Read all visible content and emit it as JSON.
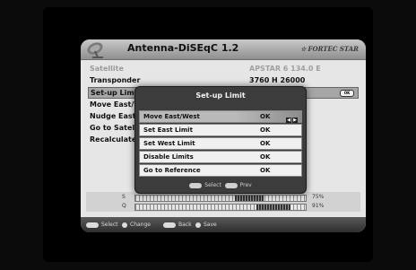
{
  "header": {
    "title": "Antenna-DiSEqC 1.2",
    "brand": "FORTEC STAR",
    "brand_star": "☆"
  },
  "rows": [
    {
      "label": "Satellite",
      "value": "APSTAR 6    134.0 E"
    },
    {
      "label": "Transponder",
      "value": "3760 H 26000"
    },
    {
      "label": "Set-up Limit",
      "value": ""
    },
    {
      "label": "Move East/W",
      "value": ""
    },
    {
      "label": "Nudge East/W",
      "value": ""
    },
    {
      "label": "Go to Satellite",
      "value": ""
    },
    {
      "label": "Recalculate",
      "value": ""
    }
  ],
  "ok_key": "OK",
  "signal": {
    "strength_label": "S",
    "quality_label": "Q",
    "strength_pct": "75%",
    "quality_pct": "91%",
    "strength_value": 75,
    "quality_value": 91
  },
  "footer": {
    "select": "Select",
    "change": "Change",
    "back": "Back",
    "save": "Save"
  },
  "popup": {
    "title": "Set-up Limit",
    "items": [
      {
        "label": "Move East/West",
        "value": "OK"
      },
      {
        "label": "Set East Limit",
        "value": "OK"
      },
      {
        "label": "Set West Limit",
        "value": "OK"
      },
      {
        "label": "Disable Limits",
        "value": "OK"
      },
      {
        "label": "Go to Reference",
        "value": "OK"
      }
    ],
    "arrow_left": "◀",
    "arrow_right": "▶",
    "hint_select": "Select",
    "hint_prev": "Prev"
  },
  "colors": {
    "panel_bg": "#e6e6e6",
    "popup_bg": "#3c3c3c",
    "highlight": "#a6a6a6"
  }
}
